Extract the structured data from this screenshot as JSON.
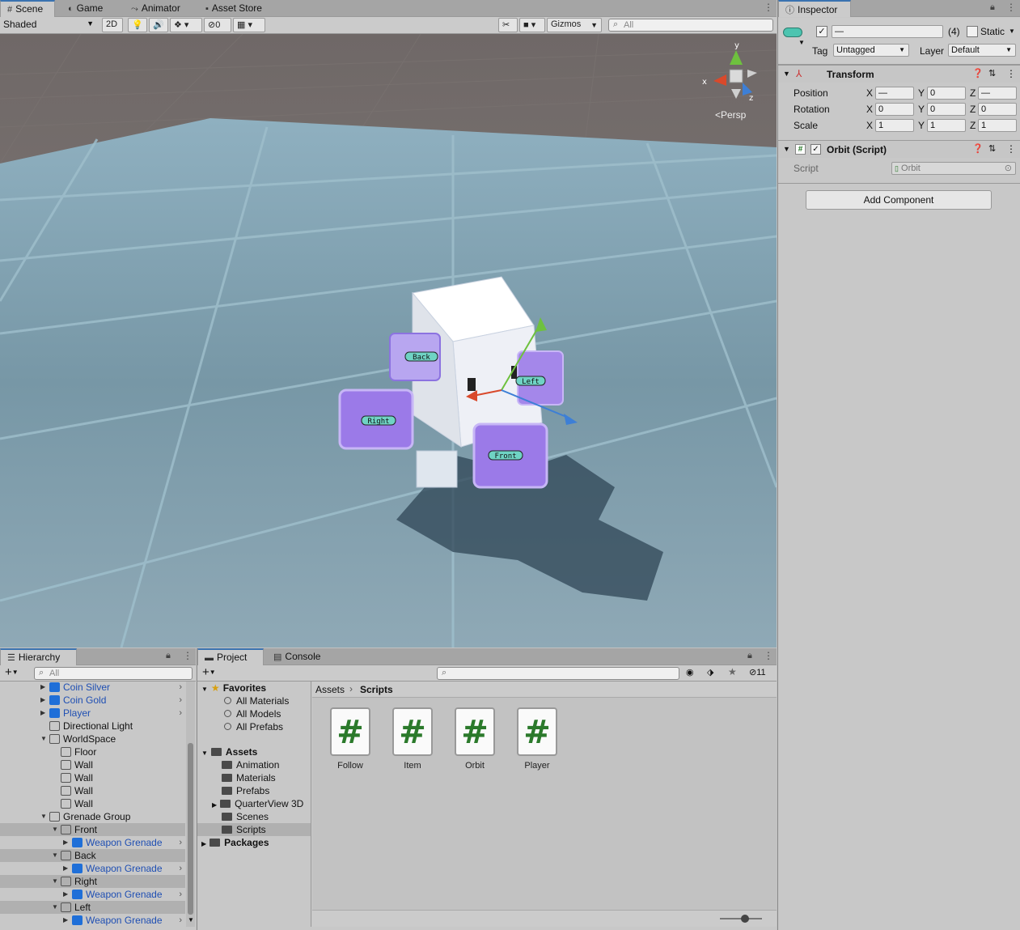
{
  "scene_tabs": [
    {
      "label": "Scene",
      "icon": "grid-icon"
    },
    {
      "label": "Game",
      "icon": "gamepad-icon"
    },
    {
      "label": "Animator",
      "icon": "animator-icon"
    },
    {
      "label": "Asset Store",
      "icon": "store-icon"
    }
  ],
  "scene_toolbar": {
    "shading": "Shaded",
    "mode_2d": "2D",
    "hidden_count": "0",
    "gizmos": "Gizmos",
    "search_placeholder": "All"
  },
  "viewport": {
    "persp_label": "<Persp",
    "axis_x": "x",
    "axis_y": "y",
    "axis_z": "z",
    "labels": {
      "back": "Back",
      "left": "Left",
      "right": "Right",
      "front": "Front"
    }
  },
  "inspector": {
    "tab": "Inspector",
    "object_name": "—",
    "multi_count": "(4)",
    "static_label": "Static",
    "tag_label": "Tag",
    "tag_value": "Untagged",
    "layer_label": "Layer",
    "layer_value": "Default",
    "transform": {
      "title": "Transform",
      "position": {
        "label": "Position",
        "x": "—",
        "y": "0",
        "z": "—"
      },
      "rotation": {
        "label": "Rotation",
        "x": "0",
        "y": "0",
        "z": "0"
      },
      "scale": {
        "label": "Scale",
        "x": "1",
        "y": "1",
        "z": "1"
      },
      "x": "X",
      "y": "Y",
      "z": "Z"
    },
    "script_component": {
      "title": "Orbit (Script)",
      "script_label": "Script",
      "script_value": "Orbit"
    },
    "add_component": "Add Component"
  },
  "hierarchy": {
    "tab": "Hierarchy",
    "search_placeholder": "All",
    "items": [
      {
        "label": "Coin Silver",
        "blue": true
      },
      {
        "label": "Coin Gold",
        "blue": true
      },
      {
        "label": "Player",
        "blue": true
      },
      {
        "label": "Directional Light"
      },
      {
        "label": "WorldSpace"
      },
      {
        "label": "Floor"
      },
      {
        "label": "Wall"
      },
      {
        "label": "Wall"
      },
      {
        "label": "Wall"
      },
      {
        "label": "Wall"
      },
      {
        "label": "Grenade Group"
      },
      {
        "label": "Front"
      },
      {
        "label": "Weapon Grenade",
        "blue": true
      },
      {
        "label": "Back"
      },
      {
        "label": "Weapon Grenade",
        "blue": true
      },
      {
        "label": "Right"
      },
      {
        "label": "Weapon Grenade",
        "blue": true
      },
      {
        "label": "Left"
      },
      {
        "label": "Weapon Grenade",
        "blue": true
      }
    ]
  },
  "project": {
    "tabs": [
      "Project",
      "Console"
    ],
    "hidden_count": "11",
    "favorites": {
      "title": "Favorites",
      "items": [
        "All Materials",
        "All Models",
        "All Prefabs"
      ]
    },
    "assets": {
      "title": "Assets",
      "items": [
        "Animation",
        "Materials",
        "Prefabs",
        "QuarterView 3D",
        "Scenes",
        "Scripts"
      ]
    },
    "packages": "Packages",
    "breadcrumb": {
      "root": "Assets",
      "current": "Scripts"
    },
    "files": [
      "Follow",
      "Item",
      "Orbit",
      "Player"
    ]
  }
}
